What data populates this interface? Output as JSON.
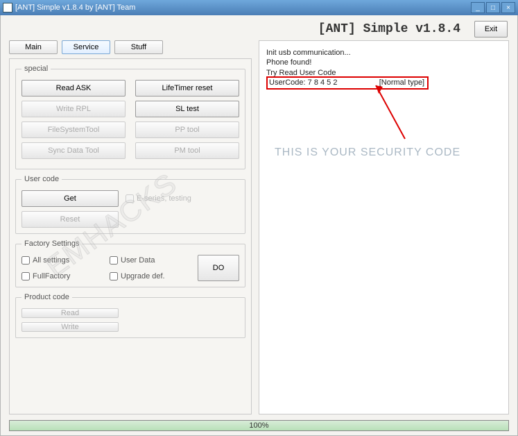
{
  "window": {
    "title": "[ANT] Simple v1.8.4 by [ANT] Team"
  },
  "header": {
    "title": "[ANT] Simple v1.8.4",
    "exit": "Exit"
  },
  "tabs": {
    "main": "Main",
    "service": "Service",
    "stuff": "Stuff"
  },
  "special": {
    "legend": "special",
    "read_ask": "Read ASK",
    "lifetimer": "LifeTimer reset",
    "write_rpl": "Write RPL",
    "sl_test": "SL test",
    "fstool": "FileSystemTool",
    "pptool": "PP tool",
    "syncdata": "Sync Data Tool",
    "pmtool": "PM tool"
  },
  "usercode": {
    "legend": "User code",
    "get": "Get",
    "eseries": "E-series, testing",
    "reset": "Reset"
  },
  "factory": {
    "legend": "Factory Settings",
    "all": "All settings",
    "userdata": "User Data",
    "fullfactory": "FullFactory",
    "upgrade": "Upgrade def.",
    "do": "DO"
  },
  "product": {
    "legend": "Product code",
    "read": "Read",
    "write": "Write"
  },
  "log": {
    "l1": "Init usb communication...",
    "l2": "Phone found!",
    "l3": "Try Read User Code",
    "uc_label": "UserCode:",
    "uc_value": "7 8 4 5 2",
    "uc_type": "[Normal type]"
  },
  "annotation": "This is your Security code",
  "watermark": "EMHACKS",
  "progress": {
    "text": "100%"
  }
}
